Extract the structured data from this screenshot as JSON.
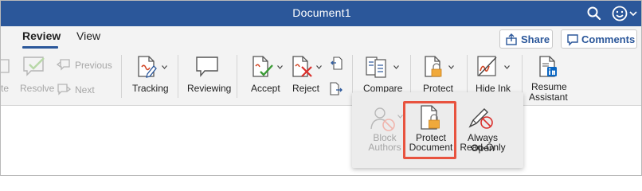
{
  "window": {
    "title": "Document1"
  },
  "tabs": {
    "review": "Review",
    "view": "View"
  },
  "header_buttons": {
    "share": "Share",
    "comments": "Comments"
  },
  "ribbon": {
    "delete_partial": "te",
    "resolve": "Resolve",
    "previous": "Previous",
    "next": "Next",
    "tracking": "Tracking",
    "reviewing": "Reviewing",
    "accept": "Accept",
    "reject": "Reject",
    "compare": "Compare",
    "protect": "Protect",
    "hide_ink": "Hide Ink",
    "resume_assistant_line1": "Resume",
    "resume_assistant_line2": "Assistant"
  },
  "protect_menu": {
    "block_authors_line1": "Block",
    "block_authors_line2": "Authors",
    "protect_document_line1": "Protect",
    "protect_document_line2": "Document",
    "always_open_line1": "Always Open",
    "always_open_line2": "Read-Only"
  },
  "colors": {
    "titlebar": "#2b579a",
    "accent": "#2b579a",
    "highlight": "#e8533f",
    "lock": "#f0a93b"
  }
}
